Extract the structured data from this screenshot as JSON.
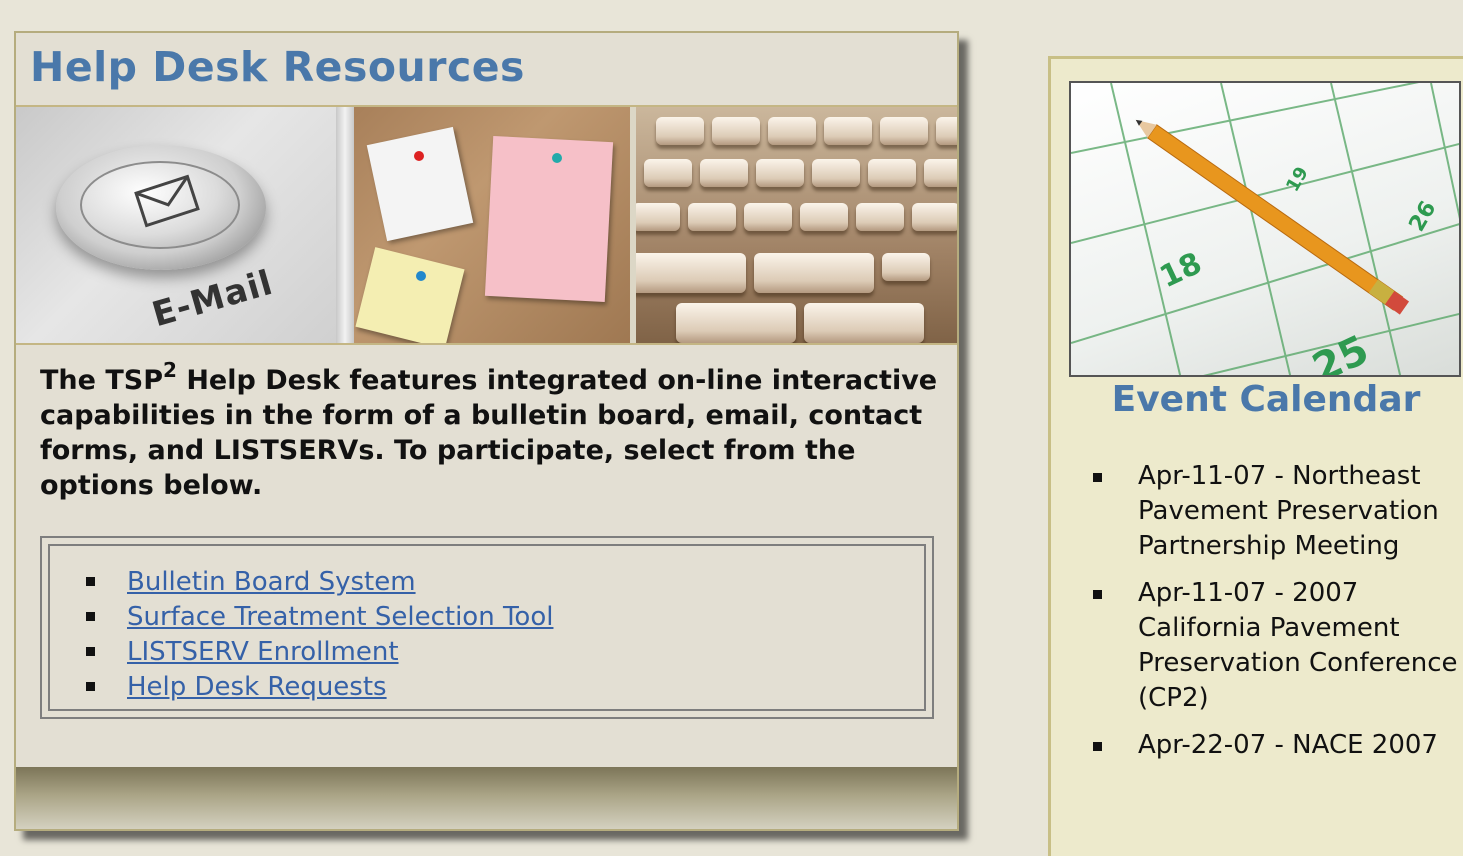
{
  "help_desk": {
    "title": "Help Desk Resources",
    "banner": {
      "email_label": "E-Mail",
      "icons": [
        "envelope-icon",
        "bulletin-board-image",
        "keyboard-image"
      ]
    },
    "intro": {
      "before_sup": "The TSP",
      "sup": "2",
      "after_sup": " Help Desk features integrated on-line interactive capabilities in the form of a bulletin board, email, contact forms, and LISTSERVs. To participate, select from the options below."
    },
    "links": [
      {
        "label": "Bulletin Board System"
      },
      {
        "label": "Surface Treatment Selection Tool"
      },
      {
        "label": "LISTSERV Enrollment"
      },
      {
        "label": "Help Desk Requests"
      }
    ]
  },
  "events": {
    "title": "Event Calendar",
    "items": [
      {
        "text": "Apr-11-07 - Northeast Pavement Preservation Partnership Meeting"
      },
      {
        "text": "Apr-11-07 - 2007 California Pavement Preservation Conference (CP2)"
      },
      {
        "text": "Apr-22-07 - NACE 2007"
      }
    ]
  },
  "colors": {
    "heading": "#4a78aa",
    "link": "#3561a8",
    "panel_bg": "#e3dfd3",
    "event_bg": "#edeacc",
    "page_bg": "#e8e5d8"
  }
}
